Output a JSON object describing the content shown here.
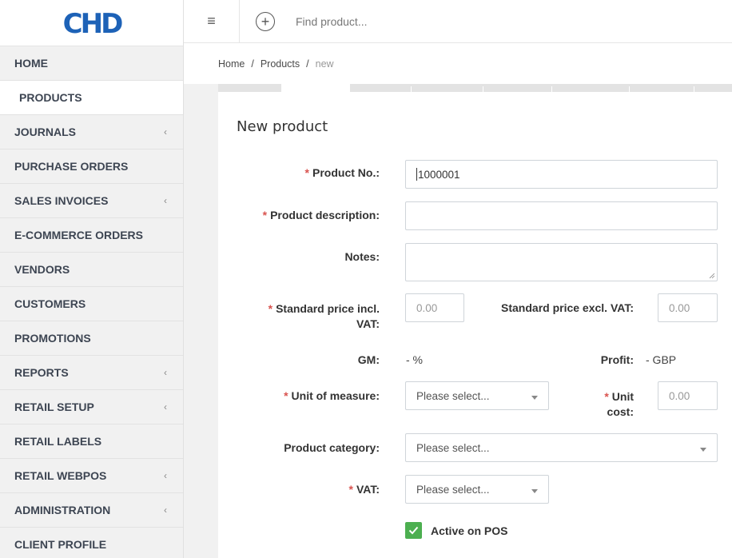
{
  "app": {
    "logo_text": "CHD"
  },
  "sidebar": {
    "items": [
      {
        "label": "HOME",
        "expandable": false
      },
      {
        "label": "PRODUCTS",
        "expandable": false,
        "active": true
      },
      {
        "label": "JOURNALS",
        "expandable": true
      },
      {
        "label": "PURCHASE ORDERS",
        "expandable": false
      },
      {
        "label": "SALES INVOICES",
        "expandable": true
      },
      {
        "label": "E-COMMERCE ORDERS",
        "expandable": false
      },
      {
        "label": "VENDORS",
        "expandable": false
      },
      {
        "label": "CUSTOMERS",
        "expandable": false
      },
      {
        "label": "PROMOTIONS",
        "expandable": false
      },
      {
        "label": "REPORTS",
        "expandable": true
      },
      {
        "label": "RETAIL SETUP",
        "expandable": true
      },
      {
        "label": "RETAIL LABELS",
        "expandable": false
      },
      {
        "label": "RETAIL WEBPOS",
        "expandable": true
      },
      {
        "label": "ADMINISTRATION",
        "expandable": true
      },
      {
        "label": "CLIENT PROFILE",
        "expandable": false
      }
    ],
    "chevron": "‹"
  },
  "topbar": {
    "menu_icon": "≡",
    "add_icon": "+",
    "search_placeholder": "Find product..."
  },
  "breadcrumb": {
    "home": "Home",
    "products": "Products",
    "current": "new",
    "separator": "/"
  },
  "form": {
    "title": "New product",
    "required_mark": "*",
    "product_no": {
      "label": "Product No.:",
      "value": "1000001"
    },
    "product_description": {
      "label": "Product description:",
      "value": ""
    },
    "notes": {
      "label": "Notes:",
      "value": ""
    },
    "price_incl": {
      "label_line1": "Standard price incl.",
      "label_line2": "VAT:",
      "placeholder": "0.00"
    },
    "price_excl": {
      "label": "Standard price excl. VAT:",
      "placeholder": "0.00"
    },
    "gm": {
      "label": "GM:",
      "value": "- %"
    },
    "profit": {
      "label": "Profit:",
      "value": "- GBP"
    },
    "unit_of_measure": {
      "label": "Unit of measure:",
      "selected": "Please select..."
    },
    "unit_cost": {
      "label_line1": "Unit",
      "label_line2": "cost:",
      "placeholder": "0.00"
    },
    "product_category": {
      "label": "Product category:",
      "selected": "Please select..."
    },
    "vat": {
      "label": "VAT:",
      "selected": "Please select..."
    },
    "active_on_pos": {
      "label": "Active on POS",
      "checked": true
    }
  },
  "colors": {
    "accent_blue": "#1d62b7",
    "required_red": "#d9534f",
    "checkbox_green": "#4caf50"
  }
}
